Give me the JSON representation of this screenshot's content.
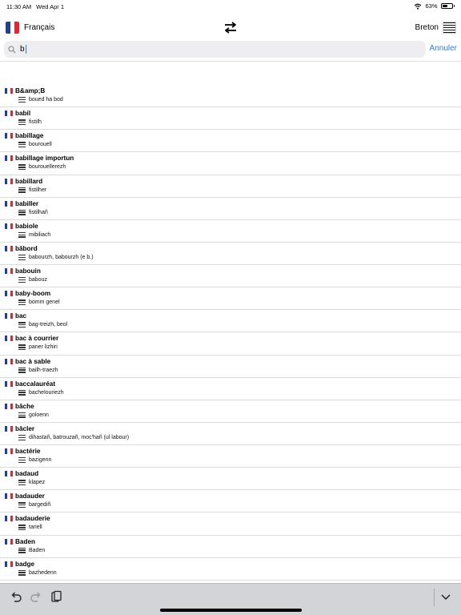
{
  "status": {
    "time": "11:30 AM",
    "date": "Wed Apr 1",
    "battery": "63%",
    "battery_level": 0.63
  },
  "header": {
    "source_language": "Français",
    "target_language": "Breton"
  },
  "search": {
    "query": "b",
    "cancel_label": "Annuler"
  },
  "entries": [
    {
      "word": "B&amp;B",
      "translation": "boued ha bod"
    },
    {
      "word": "babil",
      "translation": "fistilh"
    },
    {
      "word": "babillage",
      "translation": "bourouell"
    },
    {
      "word": "babillage importun",
      "translation": "bourouellerezh"
    },
    {
      "word": "babillard",
      "translation": "fistilher"
    },
    {
      "word": "babiller",
      "translation": "fistilhañ"
    },
    {
      "word": "babiole",
      "translation": "mibiliach"
    },
    {
      "word": "bâbord",
      "translation": "babourzh, babourzh (e b.)"
    },
    {
      "word": "babouin",
      "translation": "babouz"
    },
    {
      "word": "baby-boom",
      "translation": "bomm genel"
    },
    {
      "word": "bac",
      "translation": "bag-treizh, beol"
    },
    {
      "word": "bac à courrier",
      "translation": "paner lizhiri"
    },
    {
      "word": "bac à sable",
      "translation": "bailh-traezh"
    },
    {
      "word": "baccalauréat",
      "translation": "bachelouriezh"
    },
    {
      "word": "bâche",
      "translation": "goloenn"
    },
    {
      "word": "bâcler",
      "translation": "dihastañ, batrouzañ, moc'hañ (ul labour)"
    },
    {
      "word": "bactérie",
      "translation": "bazigenn"
    },
    {
      "word": "badaud",
      "translation": "klapez"
    },
    {
      "word": "badauder",
      "translation": "bargediñ"
    },
    {
      "word": "badauderie",
      "translation": "tariell"
    },
    {
      "word": "Baden",
      "translation": "Baden"
    },
    {
      "word": "badge",
      "translation": "bazhedenn"
    }
  ],
  "icons": {
    "wifi": "wifi-icon",
    "battery": "battery-icon",
    "swap": "swap-arrows-icon",
    "search": "search-icon",
    "undo": "undo-icon",
    "redo": "redo-icon",
    "paste": "clipboard-icon",
    "dismiss": "chevron-down-icon"
  },
  "colors": {
    "accent": "#2f7bf6",
    "keyboard_bar": "#d2d4d8"
  }
}
